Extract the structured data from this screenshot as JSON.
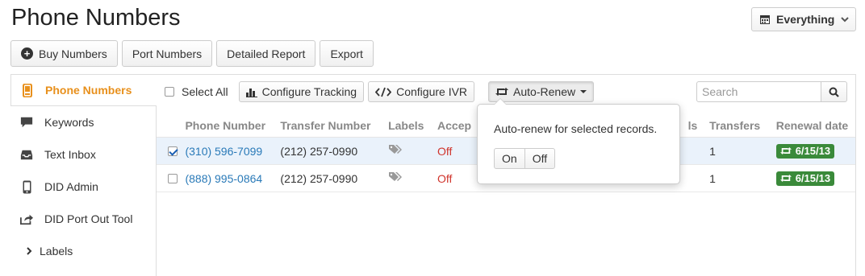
{
  "page": {
    "title": "Phone Numbers"
  },
  "filter": {
    "label": "Everything"
  },
  "top_actions": {
    "buy": "Buy Numbers",
    "port": "Port Numbers",
    "report": "Detailed Report",
    "export": "Export"
  },
  "sidebar": {
    "items": [
      {
        "label": "Phone Numbers",
        "icon": "phone-icon"
      },
      {
        "label": "Keywords",
        "icon": "speech-bubble-icon"
      },
      {
        "label": "Text Inbox",
        "icon": "inbox-icon"
      },
      {
        "label": "DID Admin",
        "icon": "mobile-icon"
      },
      {
        "label": "DID Port Out Tool",
        "icon": "share-icon"
      },
      {
        "label": "Labels",
        "icon": "chevron-right-icon"
      }
    ]
  },
  "toolbar": {
    "select_all": "Select All",
    "configure_tracking": "Configure Tracking",
    "configure_ivr": "Configure IVR",
    "auto_renew": "Auto-Renew"
  },
  "search": {
    "placeholder": "Search"
  },
  "table": {
    "headers": {
      "phone": "Phone Number",
      "transfer": "Transfer Number",
      "labels": "Labels",
      "accept": "Accep",
      "calls": "ls",
      "transfers": "Transfers",
      "renewal": "Renewal date"
    },
    "rows": [
      {
        "selected": true,
        "phone": "(310) 596-7099",
        "transfer": "(212) 257-0990",
        "accept": "Off",
        "transfers": "1",
        "renewal": "6/15/13"
      },
      {
        "selected": false,
        "phone": "(888) 995-0864",
        "transfer": "(212) 257-0990",
        "accept": "Off",
        "transfers": "1",
        "renewal": "6/15/13"
      }
    ]
  },
  "popover": {
    "text": "Auto-renew for selected records.",
    "on": "On",
    "off": "Off"
  },
  "colors": {
    "accent": "#e8901c",
    "link": "#2a7ab8",
    "off": "#d0342c",
    "badge": "#3a8a3a"
  }
}
